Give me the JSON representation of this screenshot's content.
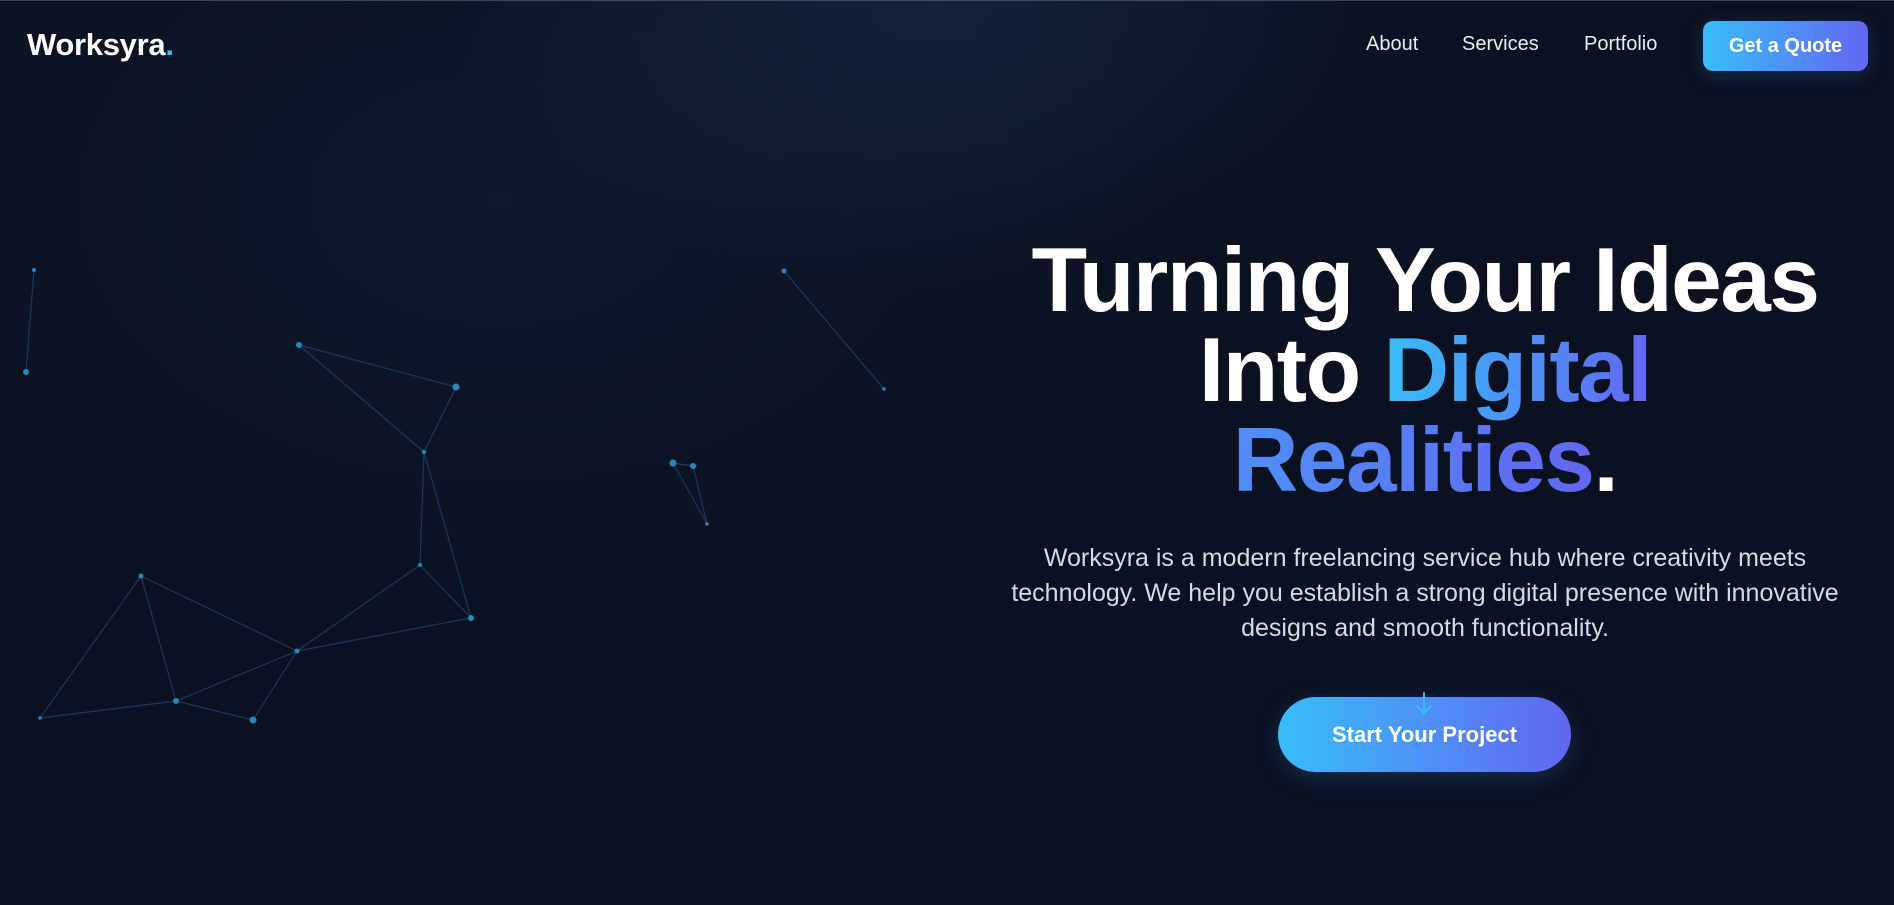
{
  "brand": {
    "name": "Worksyra",
    "dot": ".",
    "accent_color": "#38bdf8",
    "gradient_start": "#38bdf8",
    "gradient_end": "#6366f1"
  },
  "nav": {
    "items": [
      {
        "label": "About"
      },
      {
        "label": "Services"
      },
      {
        "label": "Portfolio"
      }
    ],
    "cta_label": "Get a Quote"
  },
  "hero": {
    "title_line1": "Turning Your Ideas",
    "title_into": "Into",
    "title_digital": "Digital",
    "title_realities": "Realities",
    "title_period": ".",
    "description": "Worksyra is a modern freelancing service hub where creativity meets technology. We help you establish a strong digital presence with innovative designs and smooth functionality.",
    "cta_label": "Start Your Project",
    "cta_icon": "arrow-down-icon"
  },
  "background": {
    "decoration_icon": "particle-network-icon",
    "node_color": "#2d8fc4",
    "line_color": "#1e3a5f",
    "background_color": "#0b1120"
  }
}
